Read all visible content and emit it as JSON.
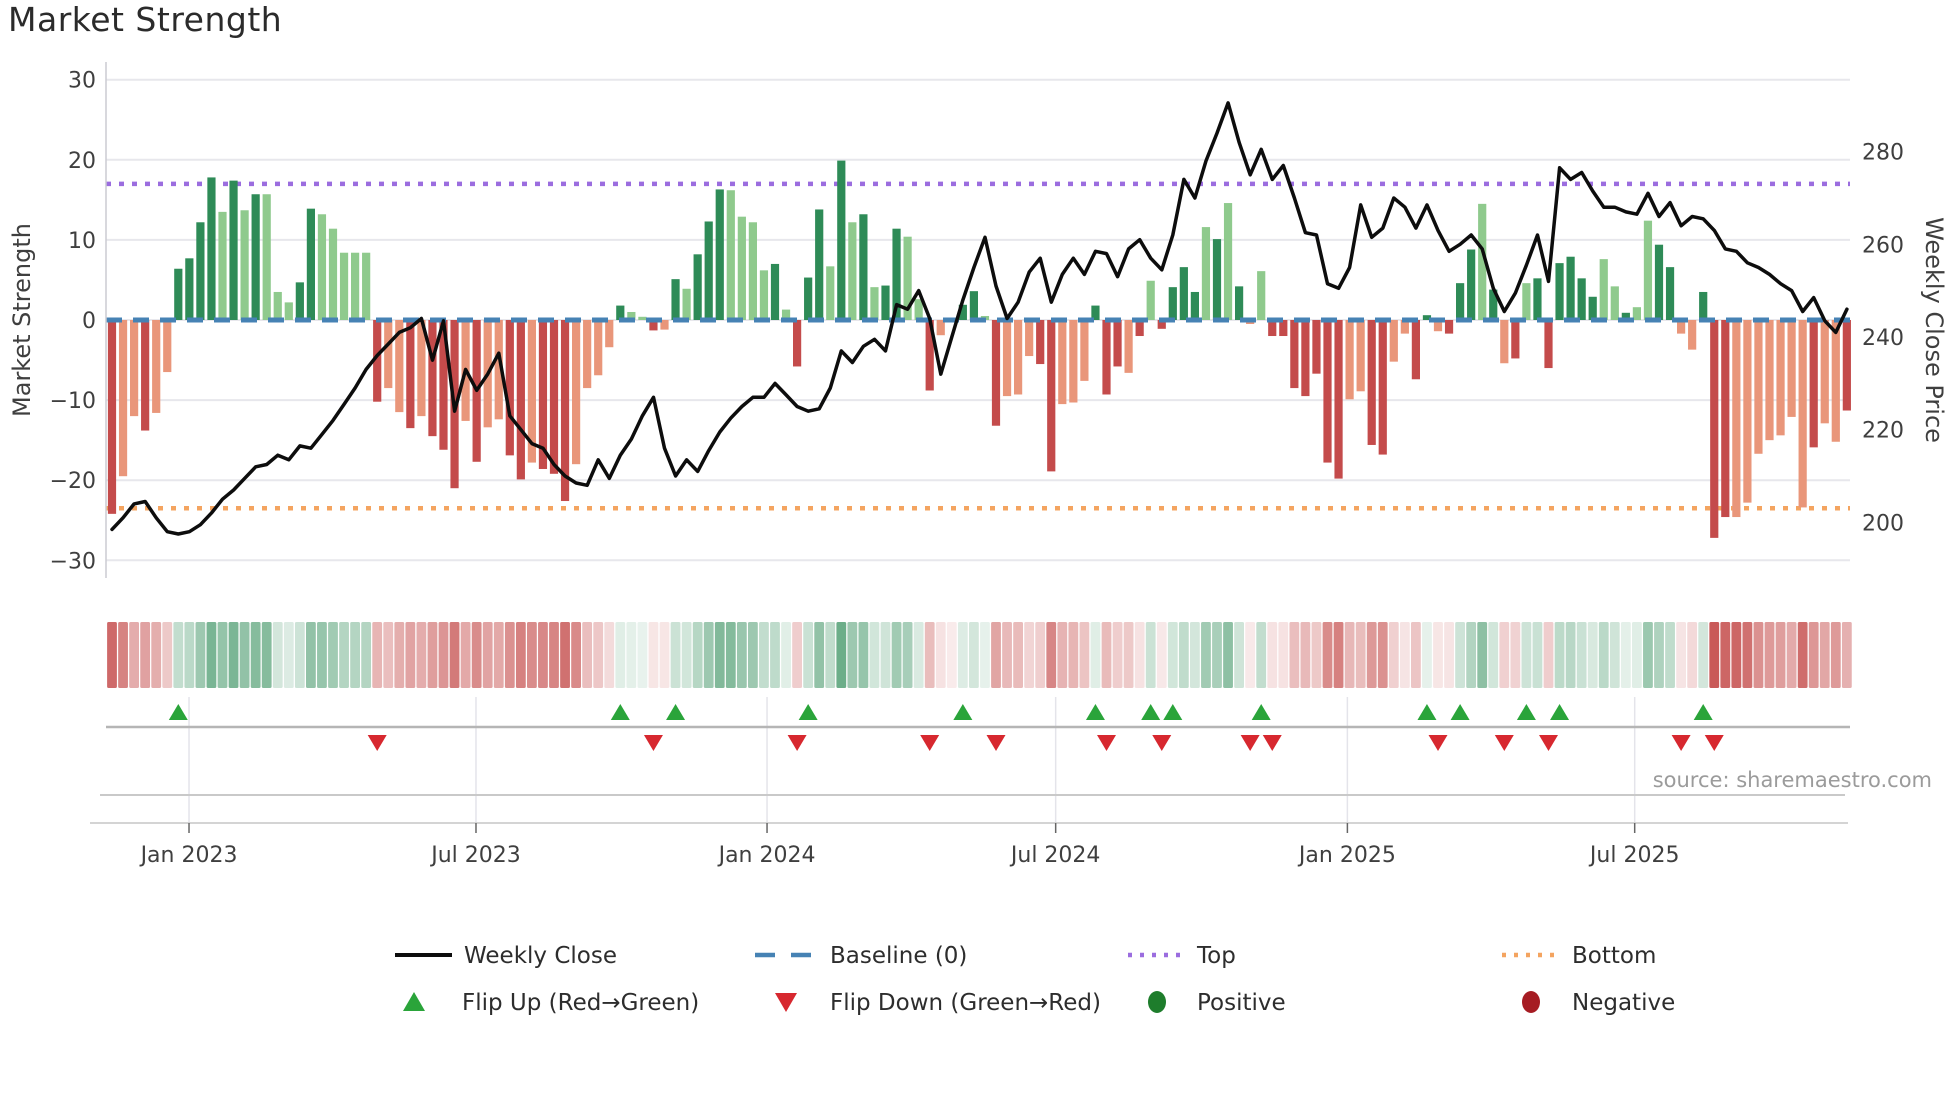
{
  "title": "Market Strength",
  "source": "source: sharemaestro.com",
  "axes": {
    "y_left": {
      "label": "Market Strength",
      "tick_labels": [
        "30",
        "20",
        "10",
        "0",
        "−10",
        "−20",
        "−30"
      ],
      "tick_values": [
        30,
        20,
        10,
        0,
        -10,
        -20,
        -30
      ],
      "range": [
        -30,
        30
      ]
    },
    "y_right": {
      "label": "Weekly Close Price",
      "tick_labels": [
        "280",
        "260",
        "240",
        "220",
        "200"
      ],
      "tick_values": [
        280,
        260,
        240,
        220,
        200
      ],
      "range": [
        197,
        292
      ]
    },
    "x": {
      "tick_labels": [
        "Jan 2023",
        "Jul 2023",
        "Jan 2024",
        "Jul 2024",
        "Jan 2025",
        "Jul 2025"
      ],
      "tick_weeks": [
        6.97,
        32.94,
        59.28,
        85.4,
        111.8,
        137.8
      ]
    }
  },
  "reference_lines": {
    "baseline": {
      "label": "Baseline (0)",
      "value": 0,
      "color": "#4682b4",
      "style": "dashed"
    },
    "top": {
      "label": "Top",
      "value": 17,
      "color": "#9b6ddf",
      "style": "dotted"
    },
    "bottom": {
      "label": "Bottom",
      "value": -23.5,
      "color": "#f4a460",
      "style": "dotted"
    }
  },
  "legend": {
    "weekly_close": "Weekly Close",
    "baseline": "Baseline (0)",
    "top": "Top",
    "bottom": "Bottom",
    "flip_up": "Flip Up (Red→Green)",
    "flip_down": "Flip Down (Green→Red)",
    "positive": "Positive",
    "negative": "Negative"
  },
  "colors": {
    "positive_dark": "#2e8b57",
    "positive_light": "#8fca8d",
    "negative_dark": "#c44b4b",
    "negative_light": "#e9967a",
    "price_line": "#0d0d0d",
    "baseline": "#4682b4",
    "top": "#9b6ddf",
    "bottom": "#f4a460",
    "flip_up": "#2aa43a",
    "flip_down": "#d7282f",
    "positive_dot": "#1e7d2c",
    "negative_dot": "#a61c23",
    "grid": "#e7e7ec",
    "spine": "#cbcbd2",
    "panel_line": "#c9c9c9",
    "marker_base_line": "#b5b5b5",
    "tick_text": "#3f3f3f"
  },
  "chart_data": {
    "type": "combo",
    "title": "Market Strength",
    "x_unit": "week",
    "weeks": 158,
    "ylabel_left": "Market Strength",
    "ylabel_right": "Weekly Close Price",
    "ylim_left": [
      -30,
      30
    ],
    "top_level": 17,
    "bottom_level": -23.5,
    "series": [
      {
        "name": "Market Strength",
        "type": "bar",
        "values": [
          -24.2,
          -19.5,
          -12,
          -13.8,
          -11.6,
          -6.5,
          6.4,
          7.7,
          12.2,
          17.8,
          13.5,
          17.4,
          13.7,
          15.7,
          15.7,
          3.5,
          2.2,
          4.7,
          13.9,
          13.2,
          11.4,
          8.4,
          8.4,
          8.4,
          -10.2,
          -8.5,
          -11.5,
          -13.5,
          -12,
          -14.5,
          -16.2,
          -21,
          -12.6,
          -17.7,
          -13.4,
          -12.4,
          -16.9,
          -19.9,
          -17.8,
          -18.6,
          -19.2,
          -22.6,
          -18,
          -8.5,
          -6.9,
          -3.4,
          1.8,
          1,
          0.4,
          -1.3,
          -1.2,
          5.1,
          3.9,
          8.2,
          12.3,
          16.3,
          16.2,
          12.9,
          12.2,
          6.2,
          7,
          1.3,
          -5.8,
          5.3,
          13.8,
          6.7,
          19.9,
          12.2,
          13.2,
          4.1,
          4.3,
          11.4,
          10.4,
          2.6,
          -8.8,
          -1.9,
          -0.3,
          1.9,
          3.6,
          0.5,
          -13.2,
          -9.5,
          -9.3,
          -4.5,
          -5.5,
          -18.9,
          -10.5,
          -10.3,
          -7.6,
          1.8,
          -9.3,
          -5.8,
          -6.6,
          -2,
          4.9,
          -1.1,
          4.1,
          6.6,
          3.5,
          11.6,
          10.1,
          14.6,
          4.2,
          -0.5,
          6.1,
          -2,
          -2,
          -8.5,
          -9.5,
          -6.7,
          -17.8,
          -19.8,
          -9.9,
          -8.9,
          -15.6,
          -16.8,
          -5.2,
          -1.7,
          -7.4,
          0.6,
          -1.4,
          -1.7,
          4.6,
          8.8,
          14.5,
          3.8,
          -5.4,
          -4.8,
          4.6,
          5.2,
          -6,
          7.1,
          7.9,
          5.2,
          2.9,
          7.6,
          4.2,
          0.9,
          1.6,
          12.4,
          9.4,
          6.6,
          -1.7,
          -3.7,
          3.5,
          -27.2,
          -24.6,
          -24.6,
          -22.8,
          -16.7,
          -15,
          -14.4,
          -12.1,
          -23.4,
          -15.9,
          -12.9,
          -15.2,
          -11.3
        ],
        "shades": "dlldllddddldldlllddllllldlldldddldllddldddlllldlldldldddlllldldddldldlddlldllddldlllddllldddldlddddldldlldddddddllddllddldddldldlddddddlldllddlldddllllllldlldl"
      },
      {
        "name": "Weekly Close",
        "type": "line",
        "values": [
          198.5,
          201,
          204,
          204.5,
          201,
          198,
          197.5,
          198,
          199.5,
          202,
          205,
          207,
          209.5,
          212,
          212.5,
          214.5,
          213.5,
          216.5,
          216,
          219,
          222,
          225.5,
          229,
          233,
          236,
          238.5,
          241,
          242,
          244,
          235,
          243.5,
          224,
          233,
          228.5,
          232,
          236.5,
          223,
          220,
          217,
          216,
          212.5,
          210,
          208.5,
          208,
          213.5,
          209.5,
          214.5,
          218,
          223,
          227,
          216,
          210,
          213.5,
          211,
          215.5,
          219.5,
          222.5,
          225,
          227,
          227,
          230,
          227.5,
          225,
          224,
          224.5,
          229,
          237,
          234.5,
          238,
          239.5,
          237,
          247,
          246,
          250,
          244,
          232,
          240,
          248,
          255,
          261.5,
          251,
          244,
          247.5,
          254,
          257,
          247.5,
          253.5,
          257,
          253.5,
          258.5,
          258,
          253,
          259,
          261,
          257,
          254.5,
          262,
          274,
          270,
          278,
          284,
          290.5,
          282,
          275,
          280.5,
          274,
          277,
          270,
          262.5,
          262,
          251.5,
          250.5,
          255,
          268.5,
          261.5,
          263.5,
          270,
          268,
          263.5,
          268.5,
          263,
          258.5,
          260,
          262,
          259,
          250.5,
          245.5,
          249.5,
          255.5,
          262,
          252,
          276.5,
          274,
          275.5,
          271.5,
          268,
          268,
          267,
          266.5,
          271,
          266,
          269,
          264,
          266,
          265.5,
          263,
          259,
          258.5,
          256,
          255,
          253.5,
          251.5,
          250,
          245.5,
          248.5,
          243.5,
          241,
          246
        ]
      }
    ],
    "flip_up_weeks": [
      6,
      46,
      51,
      63,
      77,
      89,
      94,
      96,
      104,
      119,
      122,
      128,
      131,
      144
    ],
    "flip_down_weeks": [
      24,
      49,
      62,
      74,
      80,
      90,
      95,
      103,
      105,
      120,
      126,
      130,
      142,
      145
    ],
    "heatmap": "mirrors bar values: green tint for positive weeks, red tint for negative weeks, intensity proportional to magnitude"
  }
}
